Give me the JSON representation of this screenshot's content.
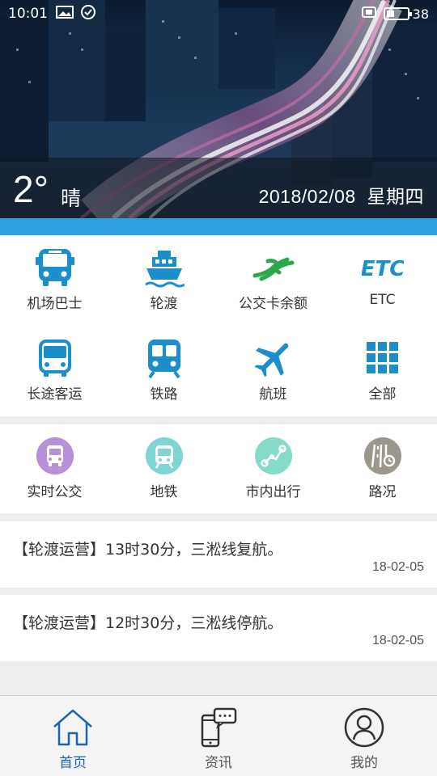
{
  "status_bar": {
    "time": "10:01",
    "battery": "38",
    "battery_level": 0.38
  },
  "weather": {
    "temperature": "2°",
    "condition": "晴",
    "date": "2018/02/08  星期四"
  },
  "services": [
    {
      "label": "机场巴士",
      "icon": "airport-bus-icon",
      "color": "#1a8fc9"
    },
    {
      "label": "轮渡",
      "icon": "ferry-icon",
      "color": "#1a8fc9"
    },
    {
      "label": "公交卡余额",
      "icon": "card-balance-icon",
      "color": "#2aa84a"
    },
    {
      "label": "ETC",
      "icon": "etc-icon",
      "color": "#1a8fc9"
    },
    {
      "label": "长途客运",
      "icon": "long-distance-bus-icon",
      "color": "#1a8fc9"
    },
    {
      "label": "铁路",
      "icon": "train-icon",
      "color": "#1a8fc9"
    },
    {
      "label": "航班",
      "icon": "airplane-icon",
      "color": "#1a8fc9"
    },
    {
      "label": "全部",
      "icon": "grid-all-icon",
      "color": "#1a8fc9"
    }
  ],
  "quick": [
    {
      "label": "实时公交",
      "icon": "realtime-bus-icon",
      "color": "#b690d8"
    },
    {
      "label": "地铁",
      "icon": "metro-icon",
      "color": "#7fd4d6"
    },
    {
      "label": "市内出行",
      "icon": "route-icon",
      "color": "#86dccb"
    },
    {
      "label": "路况",
      "icon": "road-condition-icon",
      "color": "#9c968d"
    }
  ],
  "news": [
    {
      "title": "【轮渡运营】13时30分，三淞线复航。",
      "date": "18-02-05"
    },
    {
      "title": "【轮渡运营】12时30分，三淞线停航。",
      "date": "18-02-05"
    }
  ],
  "tabs": [
    {
      "label": "首页",
      "icon": "home-icon",
      "active": true
    },
    {
      "label": "资讯",
      "icon": "news-phone-icon",
      "active": false
    },
    {
      "label": "我的",
      "icon": "profile-icon",
      "active": false
    }
  ],
  "colors": {
    "accent": "#2f9fe0",
    "active_tab": "#1e63b0"
  }
}
